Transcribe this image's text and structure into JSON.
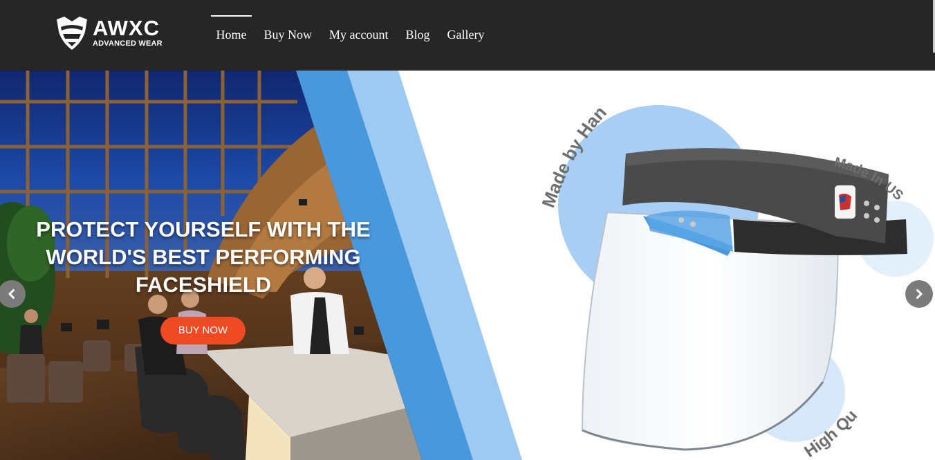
{
  "brand": {
    "name": "AWXC",
    "tagline": "ADVANCED WEAR"
  },
  "nav": {
    "items": [
      {
        "label": "Home",
        "active": true
      },
      {
        "label": "Buy Now",
        "active": false
      },
      {
        "label": "My account",
        "active": false
      },
      {
        "label": "Blog",
        "active": false
      },
      {
        "label": "Gallery",
        "active": false
      }
    ]
  },
  "hero": {
    "headline": "PROTECT YOURSELF WITH THE WORLD'S BEST PERFORMING FACESHIELD",
    "cta_label": "BUY NOW",
    "badges": {
      "made_by_hand": "Made by Hand",
      "made_in_usa": "Made In USA",
      "high_quality": "High Quality"
    },
    "prev_icon": "chevron-left-icon",
    "next_icon": "chevron-right-icon"
  },
  "colors": {
    "header_bg": "#262626",
    "cta": "#ef4a24",
    "stripe_dark": "#4a98dc",
    "stripe_light": "#9ccaf3",
    "circle": "#a8cef3"
  }
}
